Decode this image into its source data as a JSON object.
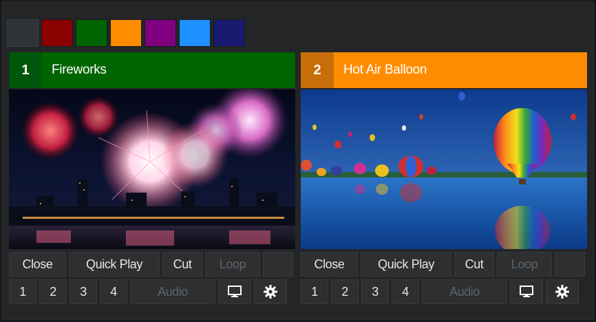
{
  "swatches": [
    {
      "name": "swatch-blank",
      "color": "#2f3236"
    },
    {
      "name": "swatch-red",
      "color": "#8b0000"
    },
    {
      "name": "swatch-green",
      "color": "#006400"
    },
    {
      "name": "swatch-orange",
      "color": "#ff8c00"
    },
    {
      "name": "swatch-purple",
      "color": "#800080"
    },
    {
      "name": "swatch-blue",
      "color": "#1e90ff"
    },
    {
      "name": "swatch-navy",
      "color": "#191970"
    }
  ],
  "panels": [
    {
      "number": "1",
      "title": "Fireworks",
      "header_color": "#006400",
      "number_bg": "#00560a",
      "image": "fireworks-over-city-skyline",
      "buttons": {
        "close": "Close",
        "quick_play": "Quick Play",
        "cut": "Cut",
        "loop": "Loop"
      },
      "channels": [
        "1",
        "2",
        "3",
        "4"
      ],
      "audio": "Audio",
      "monitor_icon": "monitor-icon",
      "settings_icon": "gear-icon"
    },
    {
      "number": "2",
      "title": "Hot Air Balloon",
      "header_color": "#ff8c00",
      "number_bg": "#c86e08",
      "image": "hot-air-balloons-over-lake",
      "buttons": {
        "close": "Close",
        "quick_play": "Quick Play",
        "cut": "Cut",
        "loop": "Loop"
      },
      "channels": [
        "1",
        "2",
        "3",
        "4"
      ],
      "audio": "Audio",
      "monitor_icon": "monitor-icon",
      "settings_icon": "gear-icon"
    }
  ]
}
